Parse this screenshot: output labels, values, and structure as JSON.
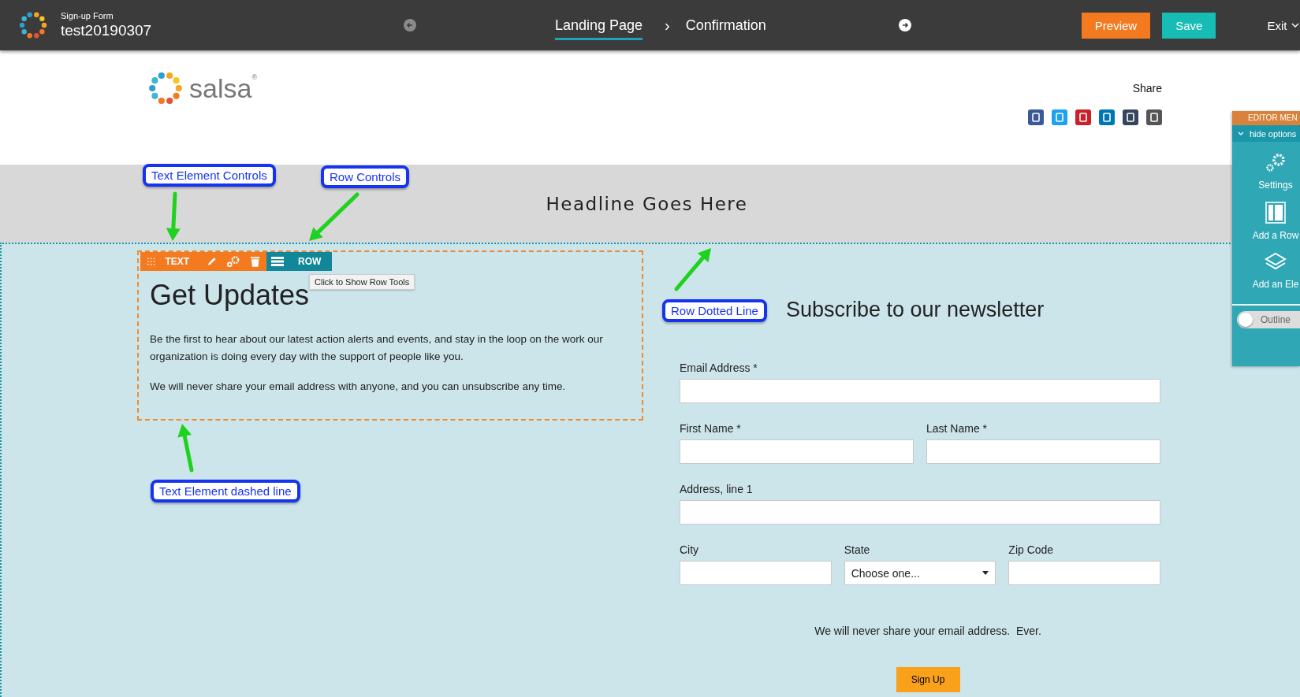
{
  "top_bar": {
    "form_type": "Sign-up Form",
    "form_name": "test20190307",
    "steps": [
      {
        "label": "Landing Page",
        "selected": true
      },
      {
        "label": "Confirmation",
        "selected": false
      }
    ],
    "step_separator": "›",
    "buttons": [
      {
        "label": "Preview",
        "kind": "preview"
      },
      {
        "label": "Save",
        "kind": "save"
      }
    ],
    "exit": "Exit"
  },
  "header": {
    "logo_text": "salsa$^{®}$",
    "share_label": "Share"
  },
  "headline": "Headline Goes Here",
  "text_element": {
    "toolbar_label": "TEXT",
    "row_label": "ROW",
    "tooltip": "Click to Show Row Tools",
    "title": "Get Updates",
    "paragraphs": [
      "Be the first to hear about our latest action alerts and events, and stay in the loop on the work our organization is doing every day with the support of people like you.",
      "We will never share your email address with anyone, and you can unsubscribe any time."
    ]
  },
  "form": {
    "title": "Subscribe to our newsletter",
    "rows": [
      [
        {
          "label": "Email Address *",
          "kind": "text"
        }
      ],
      [
        {
          "label": "First Name *",
          "kind": "text"
        },
        {
          "label": "Last Name *",
          "kind": "text"
        }
      ],
      [
        {
          "label": "Address, line 1",
          "kind": "text"
        }
      ],
      [
        {
          "label": "City",
          "kind": "text"
        },
        {
          "label": "State",
          "kind": "select",
          "value": "Choose one..."
        },
        {
          "label": "Zip Code",
          "kind": "text"
        }
      ]
    ],
    "note": "We will never share your email address.  Ever.",
    "submit": "Sign Up"
  },
  "editor_menu": {
    "title": "EDITOR MEN",
    "toggle": "hide options",
    "items": [
      {
        "label": "Settings",
        "kind": "settings"
      },
      {
        "label": "Add a Row",
        "kind": "row"
      },
      {
        "label": "Add an Ele",
        "kind": "layers"
      }
    ],
    "outline": {
      "label": "Outline",
      "on": false
    }
  },
  "annotations": [
    {
      "label": "Text Element Controls"
    },
    {
      "label": "Row Controls"
    },
    {
      "label": "Row Dotted Line"
    },
    {
      "label": "Text Element dashed line"
    }
  ]
}
